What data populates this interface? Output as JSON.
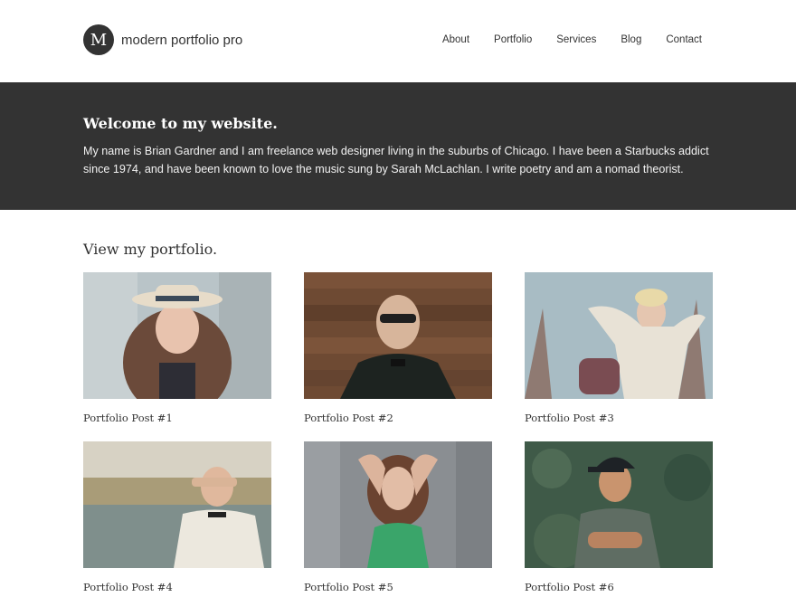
{
  "logo": {
    "letter": "M",
    "title": "modern portfolio pro"
  },
  "nav": {
    "items": [
      {
        "label": "About"
      },
      {
        "label": "Portfolio"
      },
      {
        "label": "Services"
      },
      {
        "label": "Blog"
      },
      {
        "label": "Contact"
      }
    ]
  },
  "hero": {
    "title": "Welcome to my website.",
    "text": "My name is Brian Gardner and I am freelance web designer living in the suburbs of Chicago. I have been a Starbucks addict since 1974, and have been known to love the music sung by Sarah McLachlan. I write poetry and am a nomad theorist."
  },
  "portfolio": {
    "heading": "View my portfolio.",
    "posts": [
      {
        "title": "Portfolio Post #1"
      },
      {
        "title": "Portfolio Post #2"
      },
      {
        "title": "Portfolio Post #3"
      },
      {
        "title": "Portfolio Post #4"
      },
      {
        "title": "Portfolio Post #5"
      },
      {
        "title": "Portfolio Post #6"
      }
    ]
  },
  "colors": {
    "dark": "#333333",
    "background": "#ffffff"
  }
}
